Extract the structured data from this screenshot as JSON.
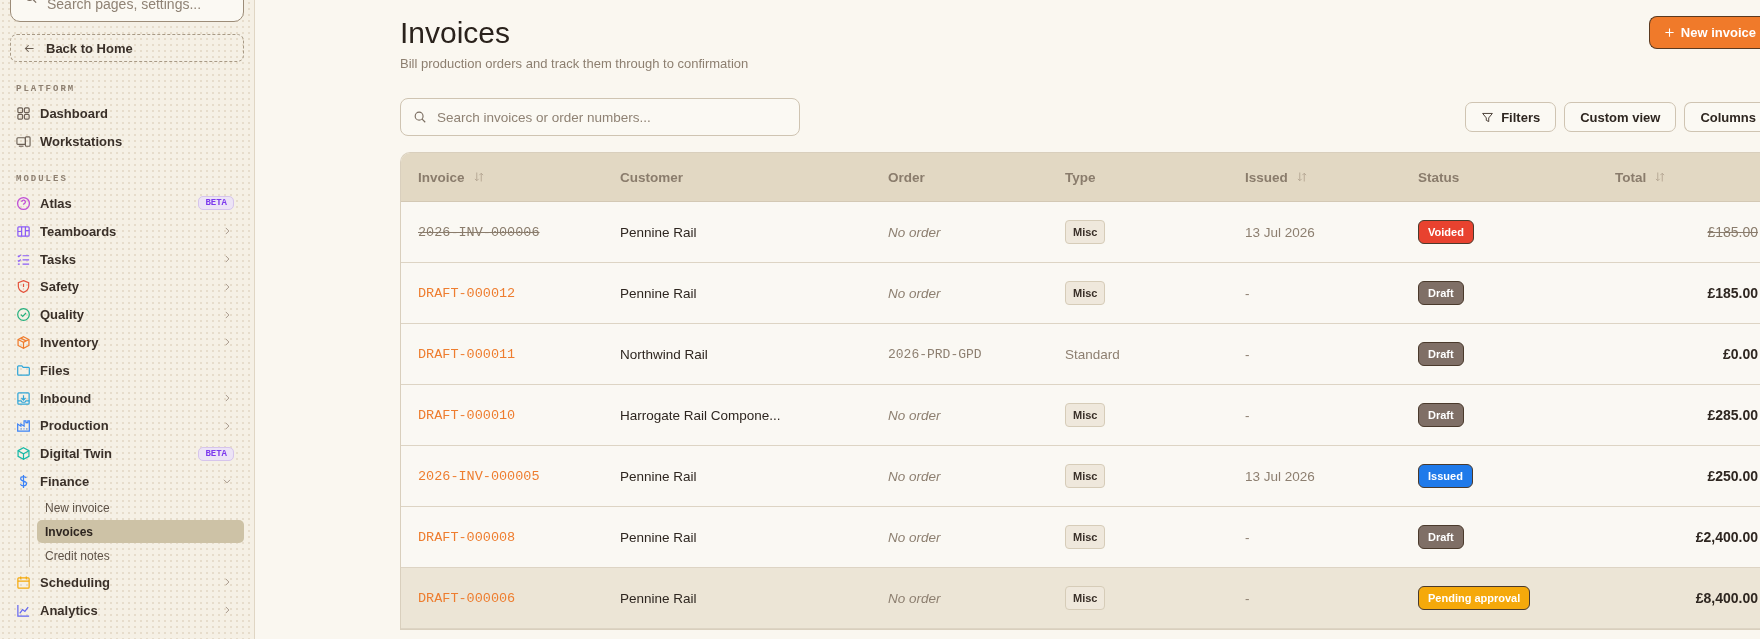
{
  "sidebar": {
    "search": {
      "placeholder": "Search pages, settings..."
    },
    "back_button": "Back to Home",
    "sections": [
      {
        "label": "PLATFORM",
        "items": [
          {
            "label": "Dashboard"
          },
          {
            "label": "Workstations"
          }
        ]
      },
      {
        "label": "MODULES",
        "items": [
          {
            "label": "Atlas",
            "badge": "BETA"
          },
          {
            "label": "Teamboards",
            "expanded": false
          },
          {
            "label": "Tasks",
            "expanded": false
          },
          {
            "label": "Safety",
            "expanded": false
          },
          {
            "label": "Quality",
            "expanded": false
          },
          {
            "label": "Inventory",
            "expanded": false
          },
          {
            "label": "Files"
          },
          {
            "label": "Inbound",
            "expanded": false
          },
          {
            "label": "Production",
            "expanded": false
          },
          {
            "label": "Digital Twin",
            "badge": "BETA"
          },
          {
            "label": "Finance",
            "expanded": true,
            "children": [
              {
                "label": "New invoice",
                "selected": false
              },
              {
                "label": "Invoices",
                "selected": true
              },
              {
                "label": "Credit notes",
                "selected": false
              }
            ]
          },
          {
            "label": "Scheduling",
            "expanded": false
          },
          {
            "label": "Analytics",
            "expanded": false
          }
        ]
      }
    ]
  },
  "header": {
    "title": "Invoices",
    "subtitle": "Bill production orders and track them through to confirmation",
    "new_button": "New invoice"
  },
  "toolbar": {
    "search": {
      "placeholder": "Search invoices or order numbers..."
    },
    "buttons": [
      {
        "label": "Filters",
        "kind": "filter"
      },
      {
        "label": "Custom view",
        "kind": "plain"
      },
      {
        "label": "Columns",
        "kind": "plain"
      }
    ]
  },
  "table": {
    "columns": [
      {
        "label": "Invoice",
        "sortable": true
      },
      {
        "label": "Customer",
        "sortable": false
      },
      {
        "label": "Order",
        "sortable": false
      },
      {
        "label": "Type",
        "sortable": false
      },
      {
        "label": "Issued",
        "sortable": true
      },
      {
        "label": "Status",
        "sortable": false
      },
      {
        "label": "Total",
        "sortable": true
      }
    ],
    "rows": [
      {
        "invoice": "2026-INV-000006",
        "customer": "Pennine Rail",
        "order": {
          "kind": "none",
          "text": "No order"
        },
        "type": {
          "kind": "tag",
          "text": "Misc"
        },
        "issued": "13 Jul 2026",
        "status": {
          "kind": "voided",
          "text": "Voided"
        },
        "total": "£185.00",
        "selected": false
      },
      {
        "invoice": "DRAFT-000012",
        "customer": "Pennine Rail",
        "order": {
          "kind": "none",
          "text": "No order"
        },
        "type": {
          "kind": "tag",
          "text": "Misc"
        },
        "issued": "-",
        "status": {
          "kind": "draft",
          "text": "Draft"
        },
        "total": "£185.00",
        "selected": false
      },
      {
        "invoice": "DRAFT-000011",
        "customer": "Northwind Rail",
        "order": {
          "kind": "code",
          "text": "2026-PRD-GPD"
        },
        "type": {
          "kind": "plain",
          "text": "Standard"
        },
        "issued": "-",
        "status": {
          "kind": "draft",
          "text": "Draft"
        },
        "total": "£0.00",
        "selected": false
      },
      {
        "invoice": "DRAFT-000010",
        "customer": "Harrogate Rail Compone...",
        "order": {
          "kind": "none",
          "text": "No order"
        },
        "type": {
          "kind": "tag",
          "text": "Misc"
        },
        "issued": "-",
        "status": {
          "kind": "draft",
          "text": "Draft"
        },
        "total": "£285.00",
        "selected": false
      },
      {
        "invoice": "2026-INV-000005",
        "customer": "Pennine Rail",
        "order": {
          "kind": "none",
          "text": "No order"
        },
        "type": {
          "kind": "tag",
          "text": "Misc"
        },
        "issued": "13 Jul 2026",
        "status": {
          "kind": "issued",
          "text": "Issued"
        },
        "total": "£250.00",
        "selected": false
      },
      {
        "invoice": "DRAFT-000008",
        "customer": "Pennine Rail",
        "order": {
          "kind": "none",
          "text": "No order"
        },
        "type": {
          "kind": "tag",
          "text": "Misc"
        },
        "issued": "-",
        "status": {
          "kind": "draft",
          "text": "Draft"
        },
        "total": "£2,400.00",
        "selected": false
      },
      {
        "invoice": "DRAFT-000006",
        "customer": "Pennine Rail",
        "order": {
          "kind": "none",
          "text": "No order"
        },
        "type": {
          "kind": "tag",
          "text": "Misc"
        },
        "issued": "-",
        "status": {
          "kind": "pending",
          "text": "Pending approval"
        },
        "total": "£8,400.00",
        "selected": true
      }
    ]
  }
}
